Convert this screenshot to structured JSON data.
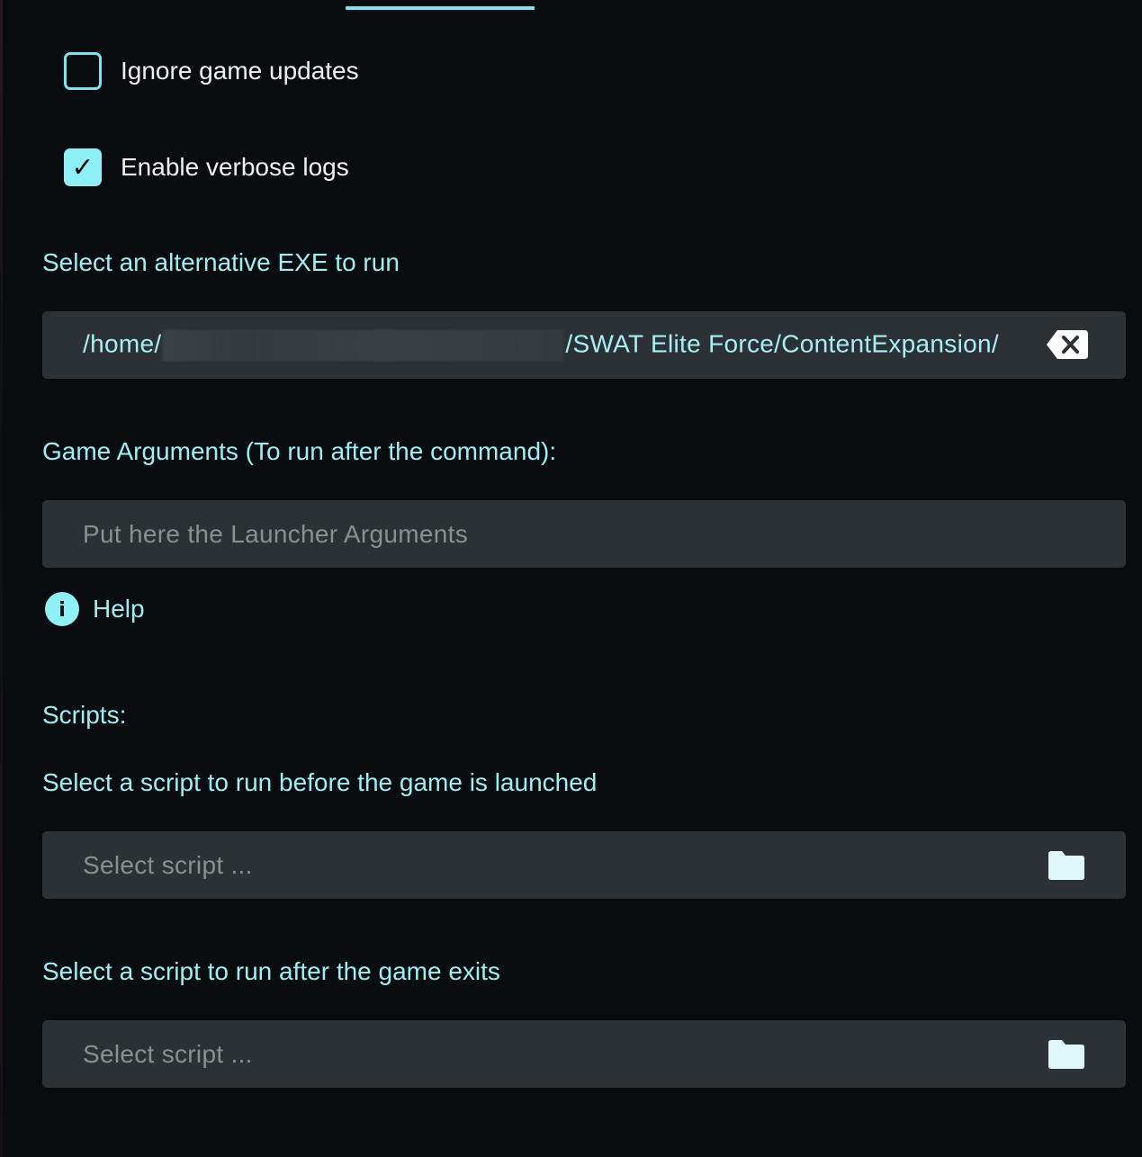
{
  "options": {
    "ignore_updates": {
      "label": "Ignore game updates",
      "checked": false
    },
    "verbose_logs": {
      "label": "Enable verbose logs",
      "checked": true,
      "check_glyph": "✓"
    }
  },
  "alt_exe": {
    "label": "Select an alternative EXE to run",
    "value_prefix": "/home/",
    "value_suffix": "/SWAT Elite Force/ContentExpansion/",
    "clear_icon": "backspace-clear-icon"
  },
  "game_args": {
    "label": "Game Arguments (To run after the command):",
    "placeholder": "Put here the Launcher Arguments"
  },
  "help": {
    "label": "Help",
    "icon": "info-icon",
    "icon_glyph": "i"
  },
  "scripts": {
    "heading": "Scripts:",
    "before": {
      "label": "Select a script to run before the game is launched",
      "placeholder": "Select script ...",
      "icon": "folder-icon"
    },
    "after": {
      "label": "Select a script to run after the game exits",
      "placeholder": "Select script ...",
      "icon": "folder-icon"
    }
  },
  "colors": {
    "accent": "#7ee3ee",
    "label_text": "#9eeef6",
    "background": "#080c0f",
    "field_background": "#2b3135",
    "placeholder_text": "#8a8f92"
  }
}
